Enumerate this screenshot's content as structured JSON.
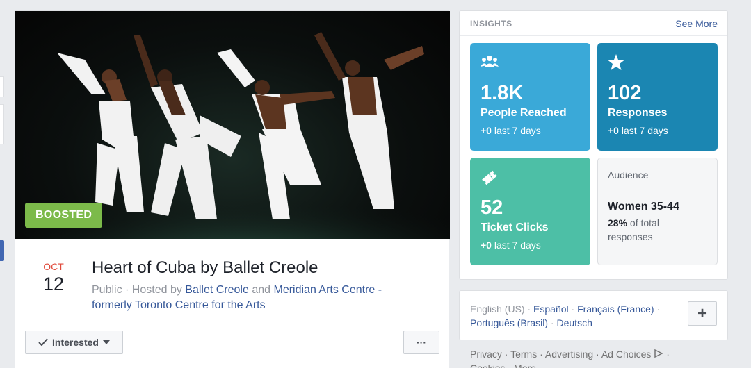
{
  "event": {
    "image_alt": "Ballet Creole dancers performing on stage",
    "badge": "BOOSTED",
    "date_month": "OCT",
    "date_day": "12",
    "title": "Heart of Cuba by Ballet Creole",
    "privacy": "Public",
    "hosted_by_prefix": " · Hosted by ",
    "host_1": "Ballet Creole",
    "host_joiner": " and ",
    "host_2": "Meridian Arts Centre - formerly Toronto Centre for the Arts",
    "interested_label": "Interested",
    "more_label": "···"
  },
  "insights": {
    "title": "INSIGHTS",
    "see_more": "See More",
    "tiles": [
      {
        "icon": "people-icon",
        "value": "1.8K",
        "label": "People Reached",
        "delta": "+0",
        "period": " last 7 days",
        "color": "#3aa9d8"
      },
      {
        "icon": "star-icon",
        "value": "102",
        "label": "Responses",
        "delta": "+0",
        "period": " last 7 days",
        "color": "#1b86b2"
      },
      {
        "icon": "ticket-icon",
        "value": "52",
        "label": "Ticket Clicks",
        "delta": "+0",
        "period": " last 7 days",
        "color": "#4dbfa6"
      }
    ],
    "audience": {
      "title": "Audience",
      "value": "Women 35-44",
      "percent": "28%",
      "detail": " of total responses"
    }
  },
  "languages": {
    "items": [
      "English (US)",
      "Español",
      "Français (France)",
      "Português (Brasil)",
      "Deutsch"
    ],
    "add_label": "+"
  },
  "footer": {
    "links": [
      "Privacy",
      "Terms",
      "Advertising",
      "Ad Choices",
      "Cookies",
      "More"
    ]
  },
  "colors": {
    "accent": "#365899",
    "boosted": "#7cba4a",
    "date_month": "#e04a3b"
  }
}
